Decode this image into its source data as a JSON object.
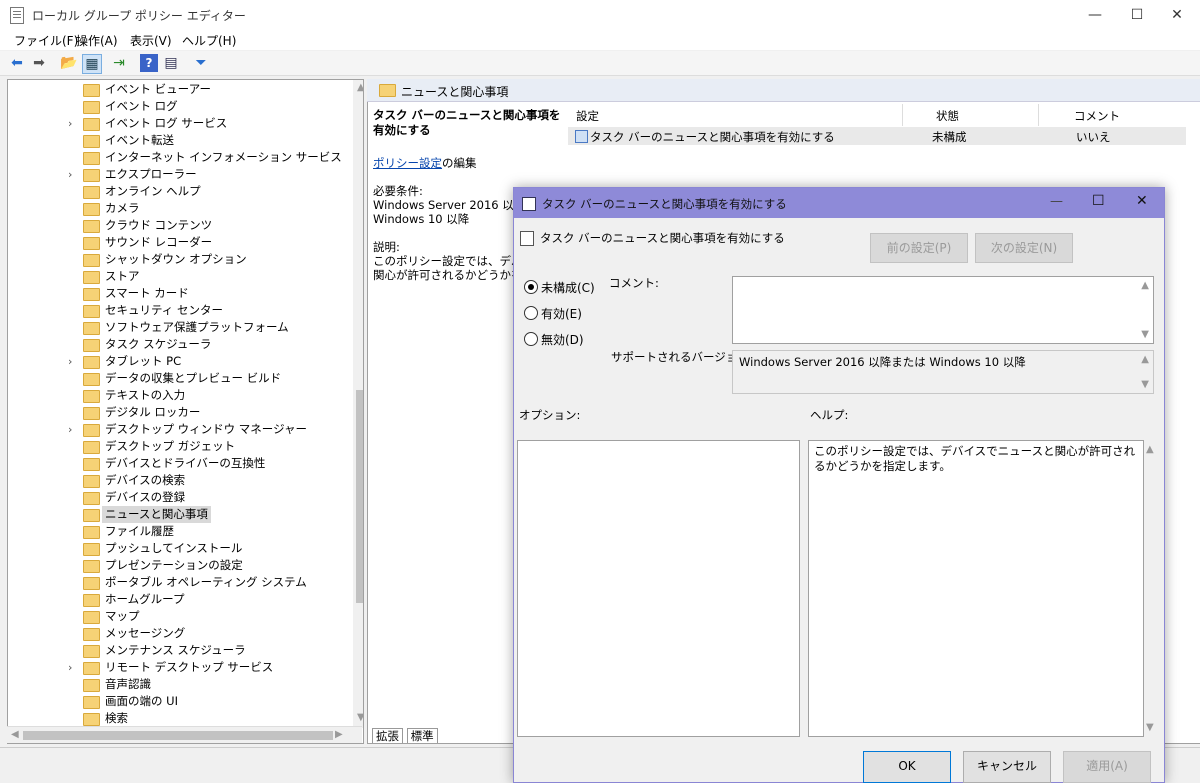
{
  "window": {
    "title": "ローカル グループ ポリシー エディター",
    "minimize": "—",
    "maximize": "☐",
    "close": "✕"
  },
  "menu": [
    "ファイル(F)",
    "操作(A)",
    "表示(V)",
    "ヘルプ(H)"
  ],
  "toolbar": {
    "icons": [
      "back-arrow-icon",
      "forward-arrow-icon",
      "folder-up-icon",
      "show-tree-icon",
      "export-list-icon",
      "help-icon",
      "properties-icon",
      "filter-icon"
    ],
    "glyphs": [
      "⬅",
      "➡",
      "📂",
      "▦",
      "⇥",
      "?",
      "▤",
      "⏷"
    ]
  },
  "tree": {
    "selected": "ニュースと関心事項",
    "items": [
      {
        "label": "イベント ビューアー",
        "expand": false
      },
      {
        "label": "イベント ログ",
        "expand": false
      },
      {
        "label": "イベント ログ サービス",
        "expand": true
      },
      {
        "label": "イベント転送",
        "expand": false
      },
      {
        "label": "インターネット インフォメーション サービス",
        "expand": false
      },
      {
        "label": "エクスプローラー",
        "expand": true
      },
      {
        "label": "オンライン ヘルプ",
        "expand": false
      },
      {
        "label": "カメラ",
        "expand": false
      },
      {
        "label": "クラウド コンテンツ",
        "expand": false
      },
      {
        "label": "サウンド レコーダー",
        "expand": false
      },
      {
        "label": "シャットダウン オプション",
        "expand": false
      },
      {
        "label": "ストア",
        "expand": false
      },
      {
        "label": "スマート カード",
        "expand": false
      },
      {
        "label": "セキュリティ センター",
        "expand": false
      },
      {
        "label": "ソフトウェア保護プラットフォーム",
        "expand": false
      },
      {
        "label": "タスク スケジューラ",
        "expand": false
      },
      {
        "label": "タブレット PC",
        "expand": true
      },
      {
        "label": "データの収集とプレビュー ビルド",
        "expand": false
      },
      {
        "label": "テキストの入力",
        "expand": false
      },
      {
        "label": "デジタル ロッカー",
        "expand": false
      },
      {
        "label": "デスクトップ ウィンドウ マネージャー",
        "expand": true
      },
      {
        "label": "デスクトップ ガジェット",
        "expand": false
      },
      {
        "label": "デバイスとドライバーの互換性",
        "expand": false
      },
      {
        "label": "デバイスの検索",
        "expand": false
      },
      {
        "label": "デバイスの登録",
        "expand": false
      },
      {
        "label": "ニュースと関心事項",
        "expand": false
      },
      {
        "label": "ファイル履歴",
        "expand": false
      },
      {
        "label": "プッシュしてインストール",
        "expand": false
      },
      {
        "label": "プレゼンテーションの設定",
        "expand": false
      },
      {
        "label": "ポータブル オペレーティング システム",
        "expand": false
      },
      {
        "label": "ホームグループ",
        "expand": false
      },
      {
        "label": "マップ",
        "expand": false
      },
      {
        "label": "メッセージング",
        "expand": false
      },
      {
        "label": "メンテナンス スケジューラ",
        "expand": false
      },
      {
        "label": "リモート デスクトップ サービス",
        "expand": true
      },
      {
        "label": "音声認識",
        "expand": false
      },
      {
        "label": "画面の端の UI",
        "expand": false
      },
      {
        "label": "検索",
        "expand": false
      }
    ]
  },
  "pane": {
    "header": "ニュースと関心事項",
    "policy_title": "タスク バーのニュースと関心事項を有効にする",
    "edit_link": "ポリシー設定",
    "edit_suffix": "の編集",
    "req_label": "必要条件:",
    "req_line1": "Windows Server 2016 以降ま",
    "req_line2": "Windows 10 以降",
    "desc_label": "説明:",
    "desc_line1": "このポリシー設定では、デバイスで",
    "desc_line2": "関心が許可されるかどうかを指定",
    "columns": {
      "setting": "設定",
      "state": "状態",
      "comment": "コメント"
    },
    "row": {
      "setting": "タスク バーのニュースと関心事項を有効にする",
      "state": "未構成",
      "comment": "いいえ"
    },
    "tabs": [
      "拡張",
      "標準"
    ]
  },
  "dialog": {
    "title": "タスク バーのニュースと関心事項を有効にする",
    "subtitle": "タスク バーのニュースと関心事項を有効にする",
    "prev_button": "前の設定(P)",
    "next_button": "次の設定(N)",
    "radios": [
      {
        "label": "未構成(C)",
        "checked": true
      },
      {
        "label": "有効(E)",
        "checked": false
      },
      {
        "label": "無効(D)",
        "checked": false
      }
    ],
    "comment_label": "コメント:",
    "supported_label": "サポートされるバージョン:",
    "supported_value": "Windows Server 2016 以降または Windows 10 以降",
    "options_label": "オプション:",
    "help_label": "ヘルプ:",
    "help_text": "このポリシー設定では、デバイスでニュースと関心が許可されるかどうかを指定します。",
    "ok_button": "OK",
    "cancel_button": "キャンセル",
    "apply_button": "適用(A)"
  },
  "colors": {
    "dialog_title_bg": "#8e8ad8",
    "folder": "#f6d276",
    "link": "#0645ad"
  }
}
